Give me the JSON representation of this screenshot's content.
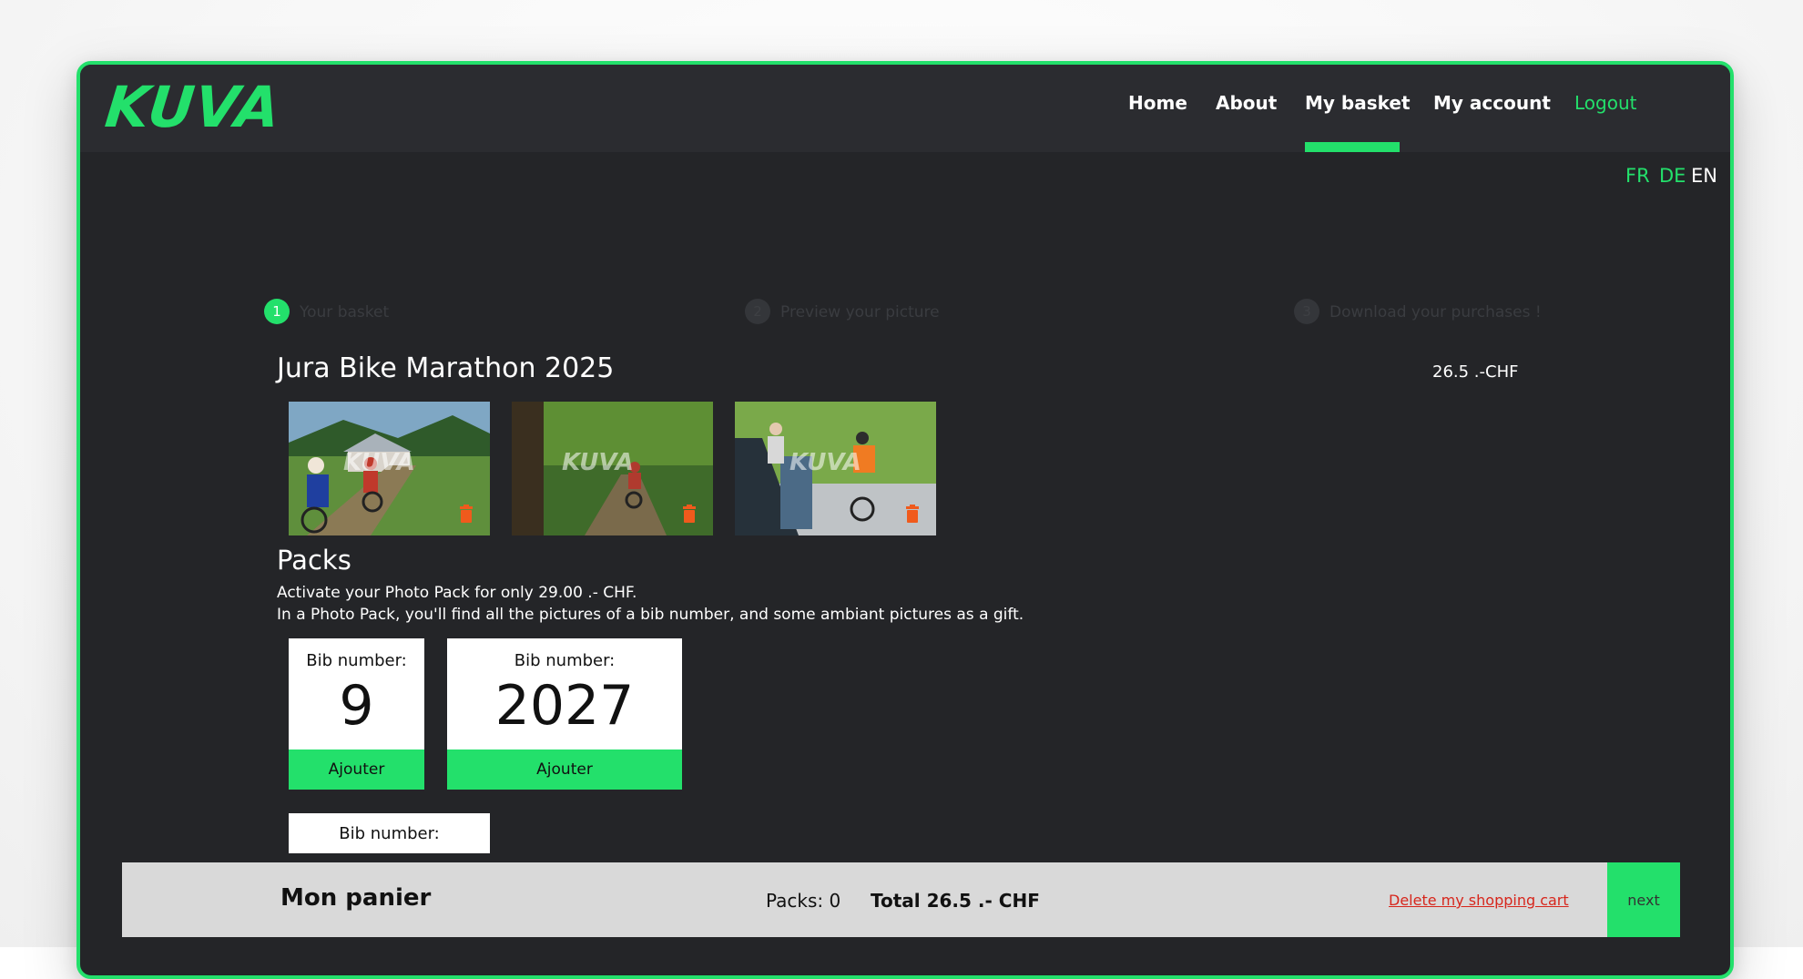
{
  "brand": {
    "logo": "KUVA",
    "accent": "#23e06b"
  },
  "nav": {
    "home": "Home",
    "about": "About",
    "basket": "My basket",
    "account": "My account",
    "logout": "Logout",
    "active": "My basket"
  },
  "languages": {
    "fr": "FR",
    "de": "DE",
    "en": "EN",
    "active": "EN"
  },
  "steps": [
    {
      "number": "1",
      "label": "Your basket",
      "active": true
    },
    {
      "number": "2",
      "label": "Preview your picture",
      "active": false
    },
    {
      "number": "3",
      "label": "Download your purchases !",
      "active": false
    }
  ],
  "event": {
    "title": "Jura Bike Marathon 2025",
    "price": "26.5 .-CHF",
    "photos": [
      {
        "watermark": "KUVA",
        "icon": "trash-icon"
      },
      {
        "watermark": "KUVA",
        "icon": "trash-icon"
      },
      {
        "watermark": "KUVA",
        "icon": "trash-icon"
      }
    ]
  },
  "packs": {
    "title": "Packs",
    "line1": "Activate your Photo Pack for only 29.00 .- CHF.",
    "line2": "In a Photo Pack, you'll find all the pictures of a bib number, and some ambiant pictures as a gift.",
    "bibs": [
      {
        "label": "Bib number:",
        "number": "9",
        "button": "Ajouter"
      },
      {
        "label": "Bib number:",
        "number": "2027",
        "button": "Ajouter"
      },
      {
        "label": "Bib number:"
      }
    ]
  },
  "cart": {
    "title": "Mon panier",
    "packs": "Packs: 0",
    "total": "Total 26.5 .- CHF",
    "delete": "Delete my shopping cart",
    "next": "next"
  }
}
